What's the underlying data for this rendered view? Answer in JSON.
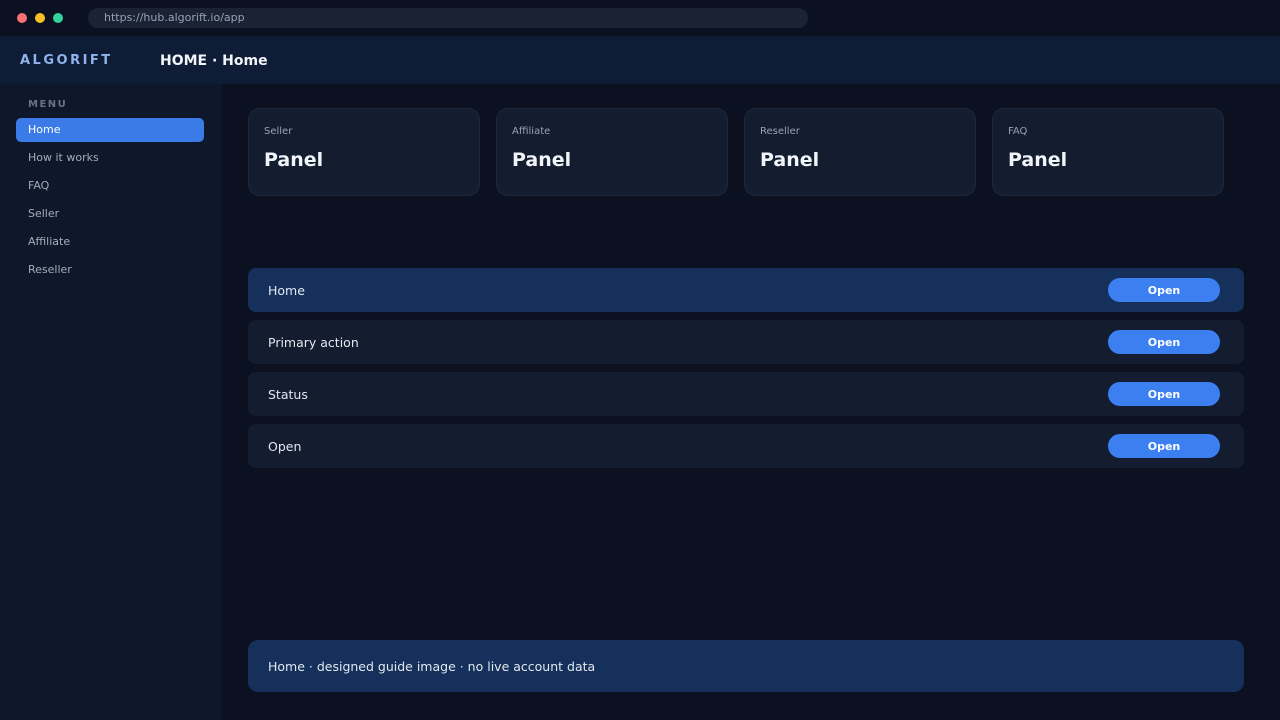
{
  "browser": {
    "url": "https://hub.algorift.io/app"
  },
  "header": {
    "logo": "ALGORIFT",
    "title": "HOME · Home"
  },
  "sidebar": {
    "heading": "MENU",
    "items": [
      {
        "label": "Home",
        "active": true
      },
      {
        "label": "How it works",
        "active": false
      },
      {
        "label": "FAQ",
        "active": false
      },
      {
        "label": "Seller",
        "active": false
      },
      {
        "label": "Affiliate",
        "active": false
      },
      {
        "label": "Reseller",
        "active": false
      }
    ]
  },
  "cards": [
    {
      "label": "Seller",
      "value": "Panel"
    },
    {
      "label": "Affiliate",
      "value": "Panel"
    },
    {
      "label": "Reseller",
      "value": "Panel"
    },
    {
      "label": "FAQ",
      "value": "Panel"
    }
  ],
  "rows": [
    {
      "label": "Home",
      "button": "Open",
      "highlighted": true
    },
    {
      "label": "Primary action",
      "button": "Open",
      "highlighted": false
    },
    {
      "label": "Status",
      "button": "Open",
      "highlighted": false
    },
    {
      "label": "Open",
      "button": "Open",
      "highlighted": false
    }
  ],
  "footer": {
    "text": "Home · designed guide image · no live account data"
  },
  "colors": {
    "accent": "#3b7ff0",
    "background": "#0b1120",
    "sidebar": "#0f172a",
    "header": "#0f1c35",
    "highlight": "#15305a",
    "card": "#141d30"
  }
}
